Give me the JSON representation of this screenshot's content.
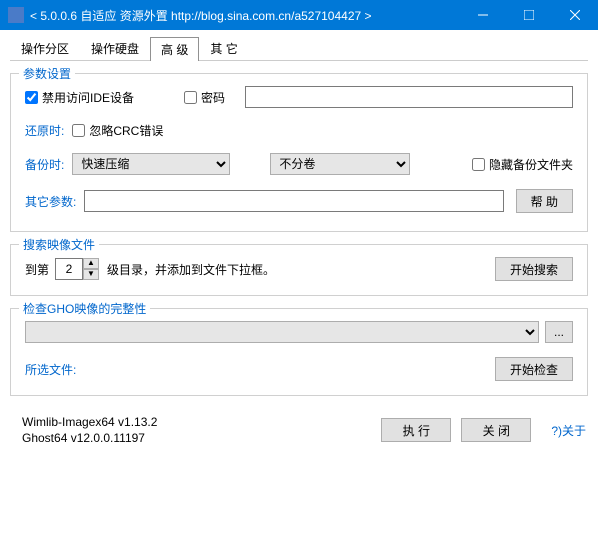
{
  "window": {
    "title": "< 5.0.0.6 自适应 资源外置 http://blog.sina.com.cn/a527104427 >"
  },
  "tabs": {
    "t0": "操作分区",
    "t1": "操作硬盘",
    "t2": "高  级",
    "t3": "其  它"
  },
  "params": {
    "title": "参数设置",
    "disable_ide": "禁用访问IDE设备",
    "password": "密码",
    "restore_label": "还原时:",
    "ignore_crc": "忽略CRC错误",
    "backup_label": "备份时:",
    "compress_option": "快速压缩",
    "split_option": "不分卷",
    "hide_backup_folder": "隐藏备份文件夹",
    "other_params_label": "其它参数:",
    "help_btn": "帮  助"
  },
  "search": {
    "title": "搜索映像文件",
    "prefix": "到第",
    "level_value": "2",
    "suffix": "级目录，并添加到文件下拉框。",
    "search_btn": "开始搜索"
  },
  "check": {
    "title": "检查GHO映像的完整性",
    "browse": "...",
    "selected_label": "所选文件:",
    "check_btn": "开始检查"
  },
  "footer": {
    "line1": "Wimlib-Imagex64 v1.13.2",
    "line2": "Ghost64 v12.0.0.11197",
    "run_btn": "执  行",
    "close_btn": "关  闭",
    "about": "?)关于"
  }
}
